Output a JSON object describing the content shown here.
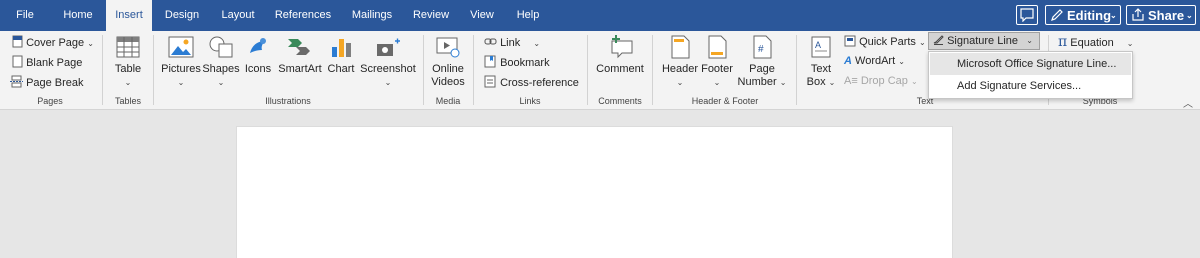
{
  "tabs": [
    "File",
    "Home",
    "Insert",
    "Design",
    "Layout",
    "References",
    "Mailings",
    "Review",
    "View",
    "Help"
  ],
  "active_tab": "Insert",
  "top_buttons": {
    "editing": "Editing",
    "share": "Share"
  },
  "groups": {
    "pages": {
      "label": "Pages",
      "items": [
        "Cover Page",
        "Blank Page",
        "Page Break"
      ]
    },
    "tables": {
      "label": "Tables",
      "table": "Table"
    },
    "illustrations": {
      "label": "Illustrations",
      "items": [
        "Pictures",
        "Shapes",
        "Icons",
        "SmartArt",
        "Chart",
        "Screenshot"
      ]
    },
    "media": {
      "label": "Media",
      "online_videos_1": "Online",
      "online_videos_2": "Videos"
    },
    "links": {
      "label": "Links",
      "items": [
        "Link",
        "Bookmark",
        "Cross-reference"
      ]
    },
    "comments": {
      "label": "Comments",
      "comment": "Comment"
    },
    "header_footer": {
      "label": "Header & Footer",
      "header": "Header",
      "footer": "Footer",
      "page_1": "Page",
      "page_2": "Number"
    },
    "text": {
      "label": "Text",
      "textbox_1": "Text",
      "textbox_2": "Box",
      "quick_parts": "Quick Parts",
      "wordart": "WordArt",
      "drop_cap": "Drop Cap",
      "signature_line": "Signature Line"
    },
    "symbols": {
      "label": "Symbols",
      "equation": "Equation"
    }
  },
  "signature_menu": [
    "Microsoft Office Signature Line...",
    "Add Signature Services..."
  ],
  "colors": {
    "brand": "#2b579a",
    "ribbon": "#f3f3f3",
    "canvas": "#e6e6e6"
  }
}
